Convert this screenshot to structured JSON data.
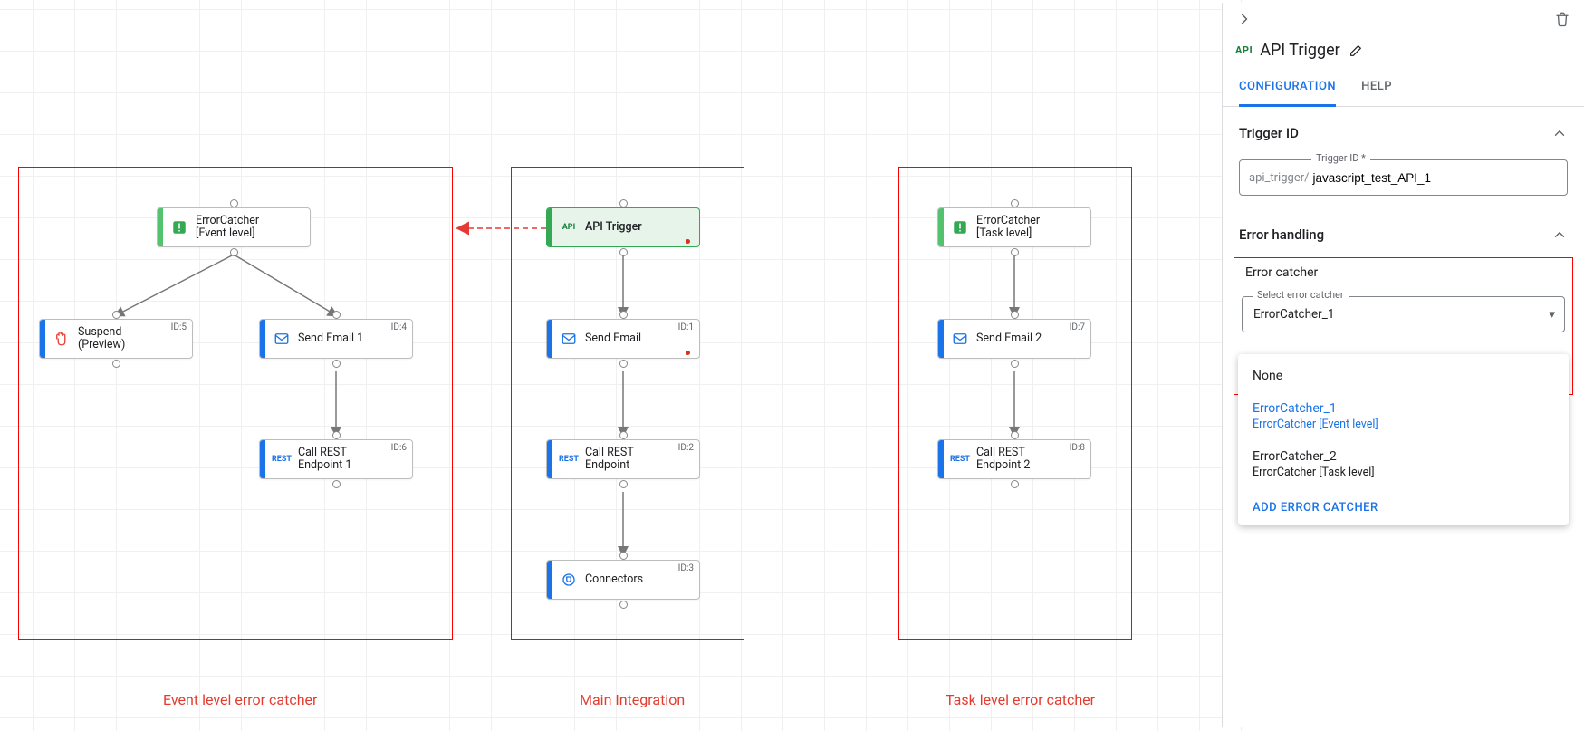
{
  "canvas": {
    "regions": {
      "event_level": {
        "label": "Event level error catcher"
      },
      "main": {
        "label": "Main Integration"
      },
      "task_level": {
        "label": "Task level error catcher"
      }
    },
    "nodes": {
      "ec_event": {
        "title": "ErrorCatcher\n[Event level]"
      },
      "suspend": {
        "title": "Suspend\n(Preview)",
        "id": "ID:5"
      },
      "send1": {
        "title": "Send Email 1",
        "id": "ID:4"
      },
      "rest1": {
        "title": "Call REST\nEndpoint 1",
        "id": "ID:6"
      },
      "api": {
        "title": "API Trigger"
      },
      "send_main": {
        "title": "Send Email",
        "id": "ID:1"
      },
      "rest_main": {
        "title": "Call REST\nEndpoint",
        "id": "ID:2"
      },
      "connectors": {
        "title": "Connectors",
        "id": "ID:3"
      },
      "ec_task": {
        "title": "ErrorCatcher\n[Task level]"
      },
      "send2": {
        "title": "Send Email 2",
        "id": "ID:7"
      },
      "rest2": {
        "title": "Call REST\nEndpoint 2",
        "id": "ID:8"
      }
    }
  },
  "panel": {
    "title": "API Trigger",
    "api_badge": "API",
    "tabs": {
      "config": "CONFIGURATION",
      "help": "HELP"
    },
    "trigger_id": {
      "section": "Trigger ID",
      "legend": "Trigger ID *",
      "prefix": "api_trigger/",
      "value": "javascript_test_API_1"
    },
    "error_handling": {
      "section": "Error handling",
      "sub_label": "Error catcher",
      "select_legend": "Select error catcher",
      "select_value": "ErrorCatcher_1",
      "options": {
        "none": "None",
        "ec1": {
          "name": "ErrorCatcher_1",
          "desc": "ErrorCatcher [Event level]"
        },
        "ec2": {
          "name": "ErrorCatcher_2",
          "desc": "ErrorCatcher [Task level]"
        },
        "add": "ADD ERROR CATCHER"
      }
    }
  }
}
